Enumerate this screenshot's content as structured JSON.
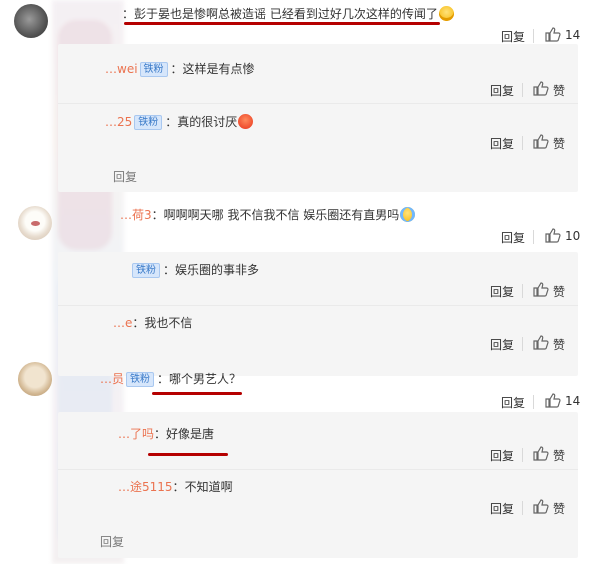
{
  "comments": [
    {
      "user": "",
      "text": "彭于晏也是惨啊总被造谣 已经看到过好几次这样的传闻了",
      "emoji": "laugh-cry-emoji",
      "reply_label": "回复",
      "likes": "14"
    },
    {
      "user": "…荷3",
      "text": "啊啊啊天哪 我不信我不信 娱乐圈还有直男吗",
      "emoji": "crying-emoji",
      "reply_label": "回复",
      "likes": "10"
    },
    {
      "user": "…员",
      "badge": "铁粉",
      "text": "哪个男艺人？",
      "reply_label": "回复",
      "likes": "14"
    }
  ],
  "replies_1": [
    {
      "user": "…wei",
      "badge": "铁粉",
      "text": "这样是有点惨",
      "reply_label": "回复",
      "like_label": "赞"
    },
    {
      "user": "…25",
      "badge": "铁粉",
      "text": "真的很讨厌",
      "emoji": "angry-emoji",
      "reply_label": "回复",
      "like_label": "赞"
    }
  ],
  "replies_2": [
    {
      "user": "",
      "badge": "铁粉",
      "text": "娱乐圈的事非多",
      "reply_label": "回复",
      "like_label": "赞"
    },
    {
      "user": "…e",
      "text": "我也不信",
      "reply_label": "回复",
      "like_label": "赞"
    }
  ],
  "replies_3": [
    {
      "user": "…了吗",
      "text": "好像是唐",
      "reply_label": "回复",
      "like_label": "赞"
    },
    {
      "user": "…途5115",
      "text": "不知道啊",
      "reply_label": "回复",
      "like_label": "赞"
    }
  ],
  "more_reply_1": "回复",
  "more_reply_3": "回复",
  "separator": "：",
  "colors": {
    "annotation_underline": "#b50000",
    "username": "#eb7350",
    "badge_bg": "#d6e6fb",
    "reply_bg": "#f5f5f5"
  }
}
